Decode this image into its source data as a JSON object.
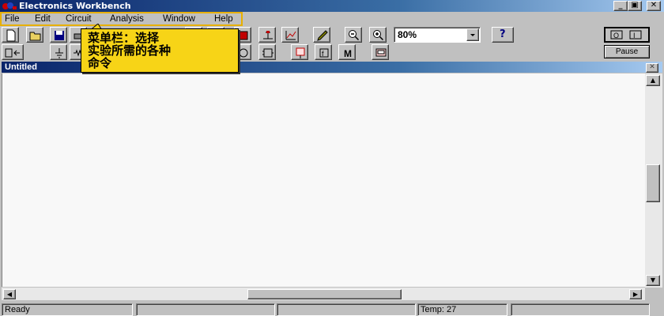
{
  "window": {
    "title": "Electronics Workbench",
    "minimize": "_",
    "maximize": "▣",
    "close": "✕"
  },
  "menu": [
    "File",
    "Edit",
    "Circuit",
    "Analysis",
    "Window",
    "Help"
  ],
  "toolbar": {
    "zoom_value": "80%",
    "help_label": "?",
    "pause_label": "Pause",
    "magnify_label": "M"
  },
  "document": {
    "title": "Untitled",
    "close": "✕"
  },
  "scroll": {
    "up": "▲",
    "down": "▼",
    "left": "◀",
    "right": "▶"
  },
  "status": {
    "message": "Ready",
    "temperature": "Temp:  27"
  },
  "annotation": {
    "text": " 菜单栏：选择\n实验所需的各种\n命令",
    "color": "#f7d417"
  },
  "colors": {
    "title_gradient_start": "#0a246a",
    "title_gradient_end": "#a6caf0",
    "menu_highlight": "#e8b000"
  }
}
